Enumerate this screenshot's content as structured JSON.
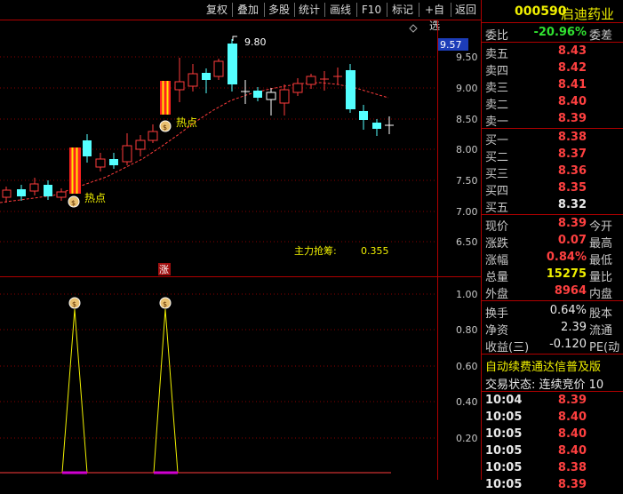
{
  "toolbar": {
    "buttons": [
      "复权",
      "叠加",
      "多股",
      "统计",
      "画线",
      "F10",
      "标记",
      "+自选",
      "返回"
    ]
  },
  "stock": {
    "code": "000590",
    "name": "启迪药业"
  },
  "chart": {
    "price_axis": [
      "9.50",
      "9.00",
      "8.50",
      "8.00",
      "7.50",
      "7.00",
      "6.50"
    ],
    "current_price_label": "9.57",
    "high_label": "9.80",
    "hot_label": "热点",
    "main_force_label": "主力抢筹:",
    "main_force_value": "0.355",
    "zhang_label": "涨",
    "indicator_axis": [
      "1.00",
      "0.80",
      "0.60",
      "0.40",
      "0.20"
    ]
  },
  "colors": {
    "up": "#ff3c3c",
    "down": "#54ffff",
    "ma": "#ff3c3c",
    "border": "#b00000"
  },
  "quote": {
    "weibi_label": "委比",
    "weibi_value": "-20.96%",
    "weicha_label": "委差",
    "sell": [
      {
        "label": "卖五",
        "price": "8.43"
      },
      {
        "label": "卖四",
        "price": "8.42"
      },
      {
        "label": "卖三",
        "price": "8.41"
      },
      {
        "label": "卖二",
        "price": "8.40"
      },
      {
        "label": "卖一",
        "price": "8.39"
      }
    ],
    "buy": [
      {
        "label": "买一",
        "price": "8.38"
      },
      {
        "label": "买二",
        "price": "8.37"
      },
      {
        "label": "买三",
        "price": "8.36"
      },
      {
        "label": "买四",
        "price": "8.35"
      },
      {
        "label": "买五",
        "price": "8.32"
      }
    ],
    "stats": [
      {
        "label": "现价",
        "value": "8.39",
        "label2": "今开"
      },
      {
        "label": "涨跌",
        "value": "0.07",
        "label2": "最高"
      },
      {
        "label": "涨幅",
        "value": "0.84%",
        "label2": "最低"
      },
      {
        "label": "总量",
        "value": "15275",
        "label2": "量比"
      },
      {
        "label": "外盘",
        "value": "8964",
        "label2": "内盘"
      }
    ],
    "stats2": [
      {
        "label": "换手",
        "value": "0.64%",
        "label2": "股本"
      },
      {
        "label": "净资",
        "value": "2.39",
        "label2": "流通"
      },
      {
        "label": "收益(三)",
        "value": "-0.120",
        "label2": "PE(动"
      }
    ],
    "banner": "自动续费通达信普及版",
    "trade_status": "交易状态: 连续竞价 10",
    "ticks": [
      {
        "time": "10:04",
        "price": "8.39"
      },
      {
        "time": "10:05",
        "price": "8.40"
      },
      {
        "time": "10:05",
        "price": "8.40"
      },
      {
        "time": "10:05",
        "price": "8.40"
      },
      {
        "time": "10:05",
        "price": "8.38"
      },
      {
        "time": "10:05",
        "price": "8.39"
      }
    ]
  }
}
